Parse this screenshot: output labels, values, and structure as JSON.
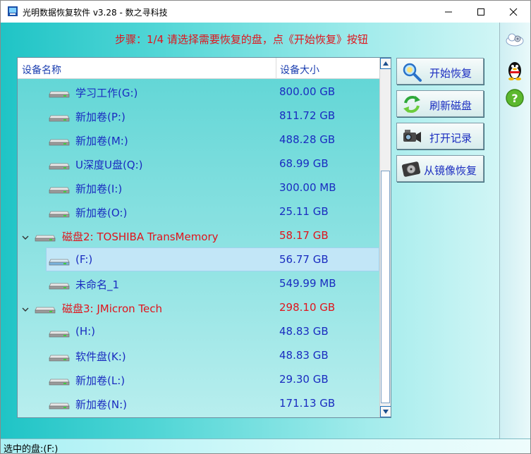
{
  "window": {
    "title": "光明数据恢复软件 v3.28 - 数之寻科技",
    "icons": {
      "app": "app-icon",
      "minimize": "minimize-icon",
      "maximize": "maximize-icon",
      "close": "close-icon"
    }
  },
  "step_instruction": "步骤：1/4 请选择需要恢复的盘，点《开始恢复》按钮",
  "device_list": {
    "columns": {
      "name": "设备名称",
      "size": "设备大小"
    },
    "rows": [
      {
        "name": "学习工作(G:)",
        "size": "800.00 GB",
        "type": "partition"
      },
      {
        "name": "新加卷(P:)",
        "size": "811.72 GB",
        "type": "partition"
      },
      {
        "name": "新加卷(M:)",
        "size": "488.28 GB",
        "type": "partition"
      },
      {
        "name": "U深度U盘(Q:)",
        "size": "68.99 GB",
        "type": "partition"
      },
      {
        "name": "新加卷(I:)",
        "size": "300.00 MB",
        "type": "partition"
      },
      {
        "name": "新加卷(O:)",
        "size": "25.11 GB",
        "type": "partition"
      },
      {
        "name": "磁盘2: TOSHIBA  TransMemory",
        "size": "58.17 GB",
        "type": "disk"
      },
      {
        "name": "(F:)",
        "size": "56.77 GB",
        "type": "partition",
        "selected": true
      },
      {
        "name": "未命名_1",
        "size": "549.99 MB",
        "type": "partition"
      },
      {
        "name": "磁盘3: JMicron  Tech",
        "size": "298.10 GB",
        "type": "disk"
      },
      {
        "name": "(H:)",
        "size": "48.83 GB",
        "type": "partition"
      },
      {
        "name": "软件盘(K:)",
        "size": "48.83 GB",
        "type": "partition"
      },
      {
        "name": "新加卷(L:)",
        "size": "29.30 GB",
        "type": "partition"
      },
      {
        "name": "新加卷(N:)",
        "size": "171.13 GB",
        "type": "partition"
      }
    ]
  },
  "actions": {
    "start_recovery": {
      "label": "开始恢复",
      "icon": "magnifier-icon"
    },
    "refresh_disks": {
      "label": "刷新磁盘",
      "icon": "refresh-icon"
    },
    "open_records": {
      "label": "打开记录",
      "icon": "camcorder-icon"
    },
    "mirror_recovery": {
      "label": "从镜像恢复",
      "icon": "hard-disk-icon"
    }
  },
  "side_panel": {
    "icons": [
      "settings-cloud-icon",
      "qq-penguin-icon",
      "help-question-icon"
    ]
  },
  "status": "选中的盘:(F:)",
  "colors": {
    "disk_label": "#e0141c",
    "partition_label": "#1a2cc0",
    "selection": "#c2e6f7",
    "instruction": "#e0141c"
  }
}
